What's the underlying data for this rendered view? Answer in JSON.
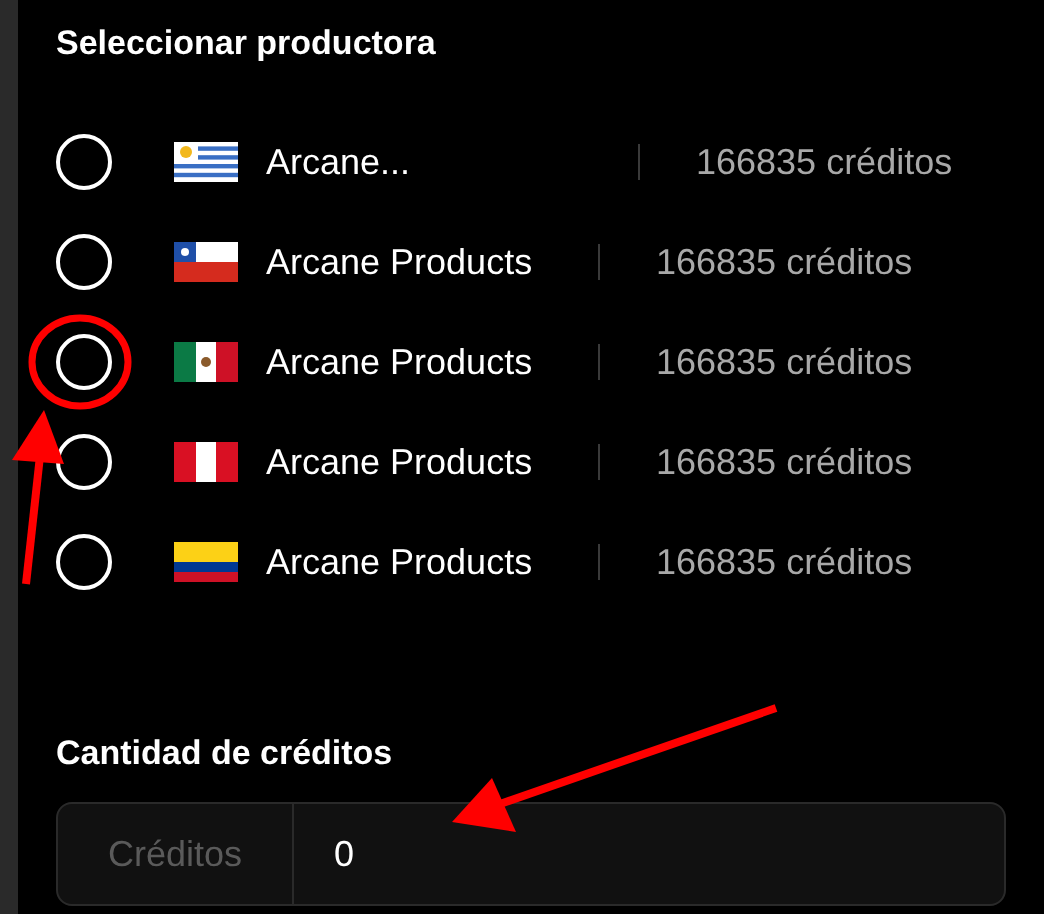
{
  "producer_section": {
    "title": "Seleccionar productora",
    "options": [
      {
        "kind": "uy",
        "name": "Arcane...",
        "credits": "166835 créditos",
        "selected": false
      },
      {
        "kind": "cl",
        "name": "Arcane Products",
        "credits": "166835 créditos",
        "selected": false
      },
      {
        "kind": "mx",
        "name": "Arcane Products",
        "credits": "166835 créditos",
        "selected": false
      },
      {
        "kind": "pe",
        "name": "Arcane Products",
        "credits": "166835 créditos",
        "selected": false
      },
      {
        "kind": "co",
        "name": "Arcane Products",
        "credits": "166835 créditos",
        "selected": false
      }
    ]
  },
  "credits_section": {
    "title": "Cantidad de créditos",
    "field": {
      "addon": "Créditos",
      "value": "0"
    }
  },
  "annotations": [
    {
      "kind": "circle"
    },
    {
      "kind": "arrow_up"
    },
    {
      "kind": "arrow_field"
    }
  ]
}
